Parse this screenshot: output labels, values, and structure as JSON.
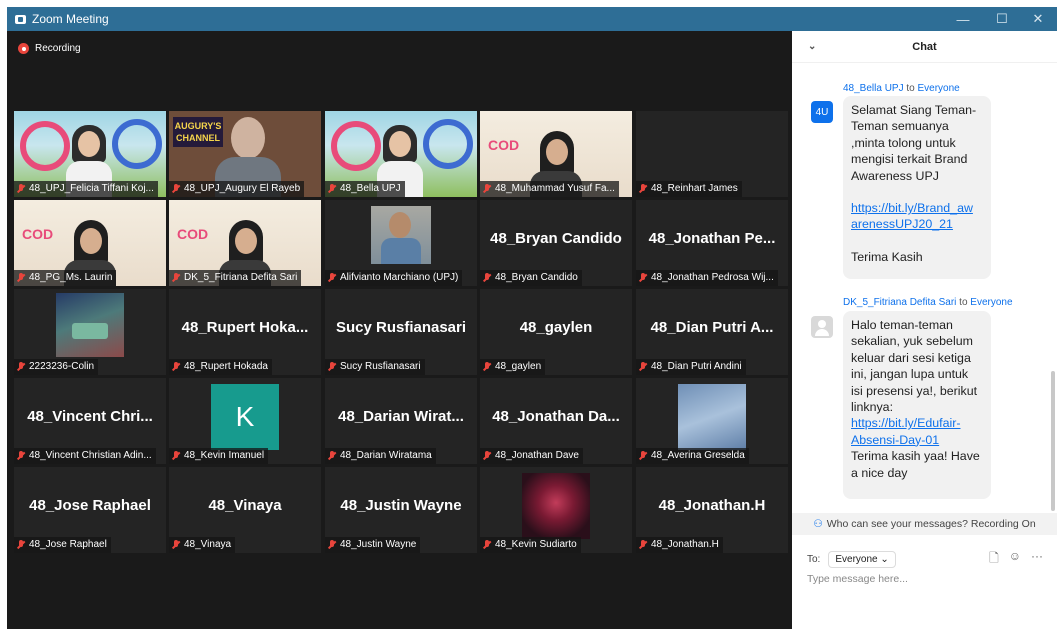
{
  "window": {
    "title": "Zoom Meeting",
    "minimize": "—",
    "maximize": "☐",
    "close": "✕"
  },
  "recording": {
    "label": "Recording"
  },
  "tiles": [
    {
      "name": "48_UPJ_Felicia Tiffani Koj...",
      "big": "",
      "video": "felicia"
    },
    {
      "name": "48_UPJ_Augury El Rayeb",
      "big": "",
      "video": "augury",
      "active": true
    },
    {
      "name": "48_Bella UPJ",
      "big": "",
      "video": "bella"
    },
    {
      "name": "48_Muhammad Yusuf Fa...",
      "big": "",
      "video": "yusuf"
    },
    {
      "name": "48_Reinhart James",
      "big": "",
      "video": "dark"
    },
    {
      "name": "48_PG_Ms. Laurin",
      "big": "",
      "video": "laurin"
    },
    {
      "name": "DK_5_Fitriana Defita Sari",
      "big": "",
      "video": "fitriana"
    },
    {
      "name": "Alifvianto Marchiano (UPJ)",
      "big": "",
      "video": "alif"
    },
    {
      "name": "48_Bryan Candido",
      "big": "48_Bryan Candido",
      "video": ""
    },
    {
      "name": "48_Jonathan Pedrosa Wij...",
      "big": "48_Jonathan Pe...",
      "video": ""
    },
    {
      "name": "2223236-Colin",
      "big": "",
      "video": "colin"
    },
    {
      "name": "48_Rupert Hokada",
      "big": "48_Rupert Hoka...",
      "video": ""
    },
    {
      "name": "Sucy Rusfianasari",
      "big": "Sucy Rusfianasari",
      "video": ""
    },
    {
      "name": "48_gaylen",
      "big": "48_gaylen",
      "video": ""
    },
    {
      "name": "48_Dian Putri Andini",
      "big": "48_Dian Putri A...",
      "video": ""
    },
    {
      "name": "48_Vincent Christian Adin...",
      "big": "48_Vincent Chri...",
      "video": ""
    },
    {
      "name": "48_Kevin Imanuel",
      "big": "",
      "video": "kevin"
    },
    {
      "name": "48_Darian Wiratama",
      "big": "48_Darian Wirat...",
      "video": ""
    },
    {
      "name": "48_Jonathan Dave",
      "big": "48_Jonathan Da...",
      "video": ""
    },
    {
      "name": "48_Averina Greselda",
      "big": "",
      "video": "sky"
    },
    {
      "name": "48_Jose Raphael",
      "big": "48_Jose Raphael",
      "video": ""
    },
    {
      "name": "48_Vinaya",
      "big": "48_Vinaya",
      "video": ""
    },
    {
      "name": "48_Justin Wayne",
      "big": "48_Justin Wayne",
      "video": ""
    },
    {
      "name": "48_Kevin Sudiarto",
      "big": "",
      "video": "anime"
    },
    {
      "name": "48_Jonathan.H",
      "big": "48_Jonathan.H",
      "video": ""
    }
  ],
  "video_text": {
    "augury_line1": "AUGURY'S",
    "augury_line2": "CHANNEL",
    "kevin_letter": "K",
    "cod": "COD"
  },
  "chat": {
    "title": "Chat",
    "messages": [
      {
        "from": "48_Bella UPJ",
        "to_word": " to ",
        "to": "Everyone",
        "avatar": "4U",
        "lines": [
          "Selamat Siang Teman-",
          "Teman semuanya",
          ",minta tolong untuk",
          "mengisi terkait Brand",
          "Awareness UPJ"
        ],
        "link1": "https://bit.ly/Brand_aw",
        "link2": "arenessUPJ20_21",
        "closing": "Terima Kasih"
      },
      {
        "from": "DK_5_Fitriana Defita Sari",
        "to_word": " to ",
        "to": "Everyone",
        "lines": [
          "Halo teman-teman",
          "sekalian, yuk sebelum",
          "keluar dari sesi ketiga",
          "ini, jangan lupa untuk",
          "isi presensi ya!, berikut",
          "linknya:"
        ],
        "link1": "https://bit.ly/Edufair-",
        "link2": "Absensi-Day-01",
        "closing1": "Terima kasih yaa! Have",
        "closing2": "a nice day"
      }
    ],
    "who_can_see": "Who can see your messages? Recording On",
    "to_label": "To:",
    "to_value": "Everyone",
    "placeholder": "Type message here..."
  },
  "colors": {
    "titlebar": "#2e6e96",
    "active_border": "#c8d86b",
    "link": "#0e71eb",
    "muted_mic": "#e8453c"
  }
}
